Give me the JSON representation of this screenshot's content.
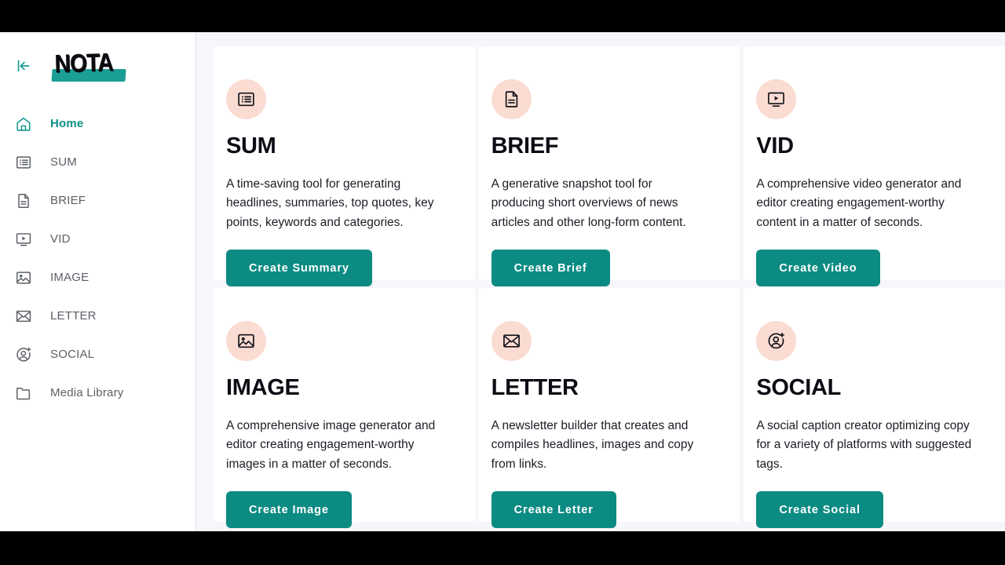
{
  "app": {
    "name": "NOTA",
    "logo_text": "NOTA"
  },
  "colors": {
    "accent_teal": "#0c8b83",
    "active_teal": "#0f8f86",
    "icon_circle_pink": "#fbdcd2",
    "sidebar_bg": "#ffffff",
    "page_bg": "#f7f6fa",
    "card_bg": "#ffffff",
    "text_dark": "#0c0d14",
    "nav_text": "#5b5f66",
    "bar_black": "#000000"
  },
  "sidebar": {
    "collapse_icon": "collapse-left-icon",
    "items": [
      {
        "label": "Home",
        "icon": "home-icon",
        "active": true
      },
      {
        "label": "SUM",
        "icon": "list-icon",
        "active": false
      },
      {
        "label": "BRIEF",
        "icon": "document-icon",
        "active": false
      },
      {
        "label": "VID",
        "icon": "video-icon",
        "active": false
      },
      {
        "label": "IMAGE",
        "icon": "image-icon",
        "active": false
      },
      {
        "label": "LETTER",
        "icon": "envelope-icon",
        "active": false
      },
      {
        "label": "SOCIAL",
        "icon": "user-plus-icon",
        "active": false
      },
      {
        "label": "Media Library",
        "icon": "folder-icon",
        "active": false
      }
    ]
  },
  "main": {
    "cards": [
      {
        "title": "SUM",
        "icon": "list-icon",
        "description": "A time-saving tool for generating headlines, summaries, top quotes, key points, keywords and categories.",
        "button_label": "Create Summary"
      },
      {
        "title": "BRIEF",
        "icon": "document-icon",
        "description": "A generative snapshot tool for producing short overviews of news articles and other long-form content.",
        "button_label": "Create Brief"
      },
      {
        "title": "VID",
        "icon": "video-icon",
        "description": "A comprehensive video generator and editor creating engagement-worthy content in a matter of seconds.",
        "button_label": "Create Video"
      },
      {
        "title": "IMAGE",
        "icon": "image-icon",
        "description": "A comprehensive image generator and editor creating engagement-worthy images in a matter of seconds.",
        "button_label": "Create Image"
      },
      {
        "title": "LETTER",
        "icon": "envelope-icon",
        "description": "A newsletter builder that creates and compiles headlines, images and copy from links.",
        "button_label": "Create Letter"
      },
      {
        "title": "SOCIAL",
        "icon": "user-plus-icon",
        "description": "A social caption creator optimizing copy for a variety of platforms with suggested tags.",
        "button_label": "Create Social"
      }
    ]
  }
}
